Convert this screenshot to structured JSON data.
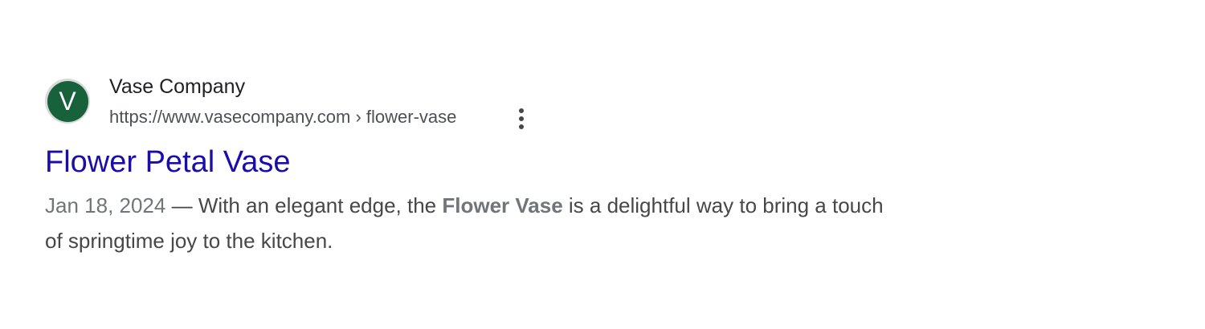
{
  "result": {
    "favicon_letter": "V",
    "site_name": "Vase Company",
    "url": "https://www.vasecompany.com › flower-vase",
    "title": "Flower Petal Vase",
    "date": "Jan 18, 2024",
    "separator": " — ",
    "snippet_before": "With an elegant edge, the ",
    "snippet_bold": "Flower Vase",
    "snippet_after": " is a delightful way to bring a touch of springtime joy to the kitchen.",
    "more_icon": "more-vertical-icon"
  },
  "colors": {
    "link": "#1a0dab",
    "favicon_bg": "#17613b",
    "text": "#474747",
    "muted": "#70757a"
  }
}
